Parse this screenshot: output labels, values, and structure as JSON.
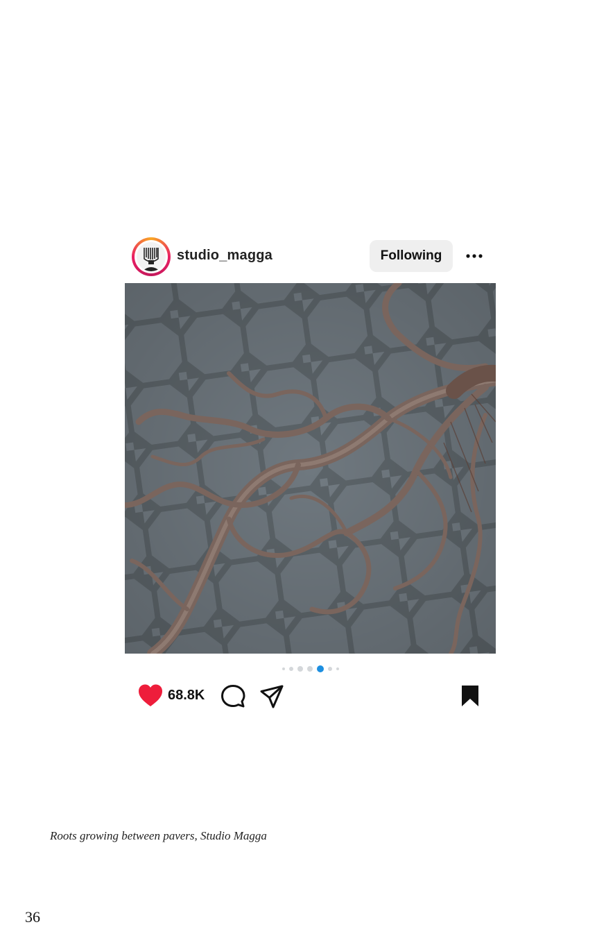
{
  "post": {
    "username": "studio_magga",
    "follow_label": "Following",
    "more_icon": "more-options-icon",
    "carousel": {
      "count": 7,
      "active_index": 4
    },
    "likes": "68.8K",
    "icons": [
      "heart-icon",
      "comment-icon",
      "share-icon",
      "bookmark-icon"
    ],
    "liked": true,
    "saved": true
  },
  "caption": "Roots growing between pavers, Studio Magga",
  "page_number": "36",
  "colors": {
    "heart": "#ee1d3b",
    "active_dot": "#1d8fe0",
    "inactive_dot": "#d4d7da",
    "follow_bg": "#efefef",
    "pavers": "#6f787f",
    "roots": "#7a655d"
  }
}
